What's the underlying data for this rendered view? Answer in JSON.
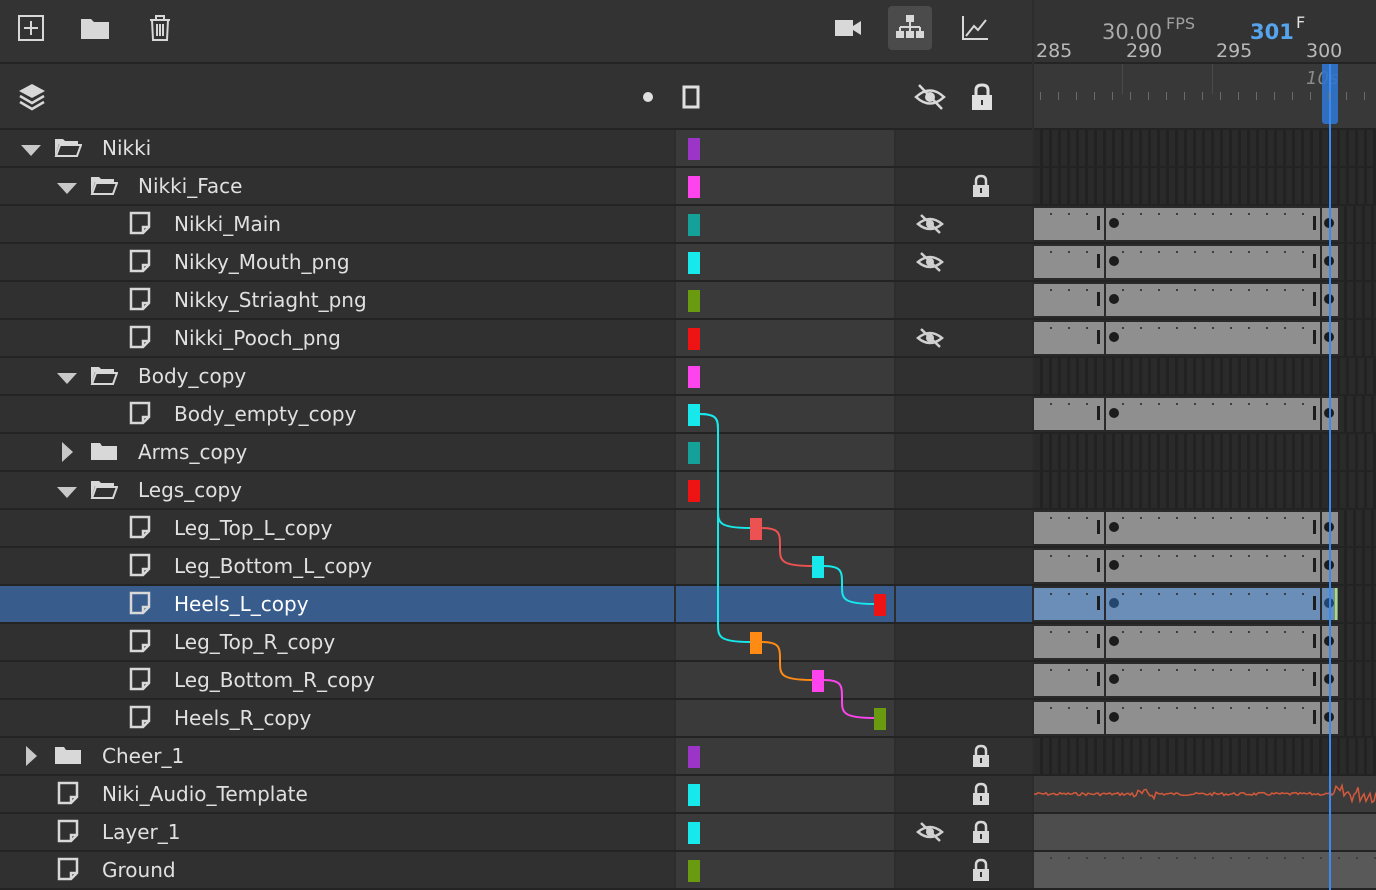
{
  "toolbar": {
    "new_layer_icon": "plus-square-icon",
    "new_folder_icon": "folder-icon",
    "delete_icon": "trash-icon",
    "camera_icon": "camera-icon",
    "parenting_icon": "hierarchy-icon",
    "graph_icon": "graph-icon",
    "fps_value": "30.00",
    "fps_unit": "FPS",
    "frame_value": "301",
    "frame_unit": "F"
  },
  "header": {
    "layers_icon": "layers-icon",
    "dot_icon": "dot-icon",
    "outline_icon": "outline-icon",
    "hide_all_icon": "eye-slash-icon",
    "lock_all_icon": "lock-icon"
  },
  "ruler": {
    "seconds_label": "10s",
    "frames": [
      "285",
      "290",
      "295",
      "300"
    ]
  },
  "colors": {
    "accent_blue": "#56a4ee",
    "playhead": "#3a8af0",
    "selection": "#385c8c",
    "audio_wave": "#d4593a"
  },
  "layers": [
    {
      "name": "Nikki",
      "type": "folder",
      "depth": 0,
      "expanded": true,
      "color": "#9b35c8",
      "hidden": false,
      "locked": false,
      "frames": "empty"
    },
    {
      "name": "Nikki_Face",
      "type": "folder",
      "depth": 1,
      "expanded": true,
      "color": "#ff44ee",
      "hidden": false,
      "locked": true,
      "frames": "empty"
    },
    {
      "name": "Nikki_Main",
      "type": "layer",
      "depth": 2,
      "color": "#14a19a",
      "hidden": true,
      "locked": false,
      "frames": "keys"
    },
    {
      "name": "Nikky_Mouth_png",
      "type": "layer",
      "depth": 2,
      "color": "#16e8ec",
      "hidden": true,
      "locked": false,
      "frames": "keys"
    },
    {
      "name": "Nikky_Striaght_png",
      "type": "layer",
      "depth": 2,
      "color": "#6a9a10",
      "hidden": false,
      "locked": false,
      "frames": "keys"
    },
    {
      "name": "Nikki_Pooch_png",
      "type": "layer",
      "depth": 2,
      "color": "#ee1414",
      "hidden": true,
      "locked": false,
      "frames": "keys"
    },
    {
      "name": "Body_copy",
      "type": "folder",
      "depth": 1,
      "expanded": true,
      "color": "#ff44ee",
      "hidden": false,
      "locked": false,
      "frames": "empty"
    },
    {
      "name": "Body_empty_copy",
      "type": "layer",
      "depth": 2,
      "color": "#16e8ec",
      "hidden": false,
      "locked": false,
      "frames": "keys"
    },
    {
      "name": "Arms_copy",
      "type": "folder",
      "depth": 1,
      "expanded": false,
      "color": "#14a19a",
      "hidden": false,
      "locked": false,
      "frames": "empty"
    },
    {
      "name": "Legs_copy",
      "type": "folder",
      "depth": 1,
      "expanded": true,
      "color": "#ee1414",
      "hidden": false,
      "locked": false,
      "frames": "empty"
    },
    {
      "name": "Leg_Top_L_copy",
      "type": "layer",
      "depth": 2,
      "color": "#ec5252",
      "hidden": false,
      "locked": false,
      "frames": "keys"
    },
    {
      "name": "Leg_Bottom_L_copy",
      "type": "layer",
      "depth": 2,
      "color": "#16e8ec",
      "hidden": false,
      "locked": false,
      "frames": "keys"
    },
    {
      "name": "Heels_L_copy",
      "type": "layer",
      "depth": 2,
      "color": "#ee1414",
      "hidden": false,
      "locked": false,
      "frames": "keys",
      "selected": true
    },
    {
      "name": "Leg_Top_R_copy",
      "type": "layer",
      "depth": 2,
      "color": "#ff8a14",
      "hidden": false,
      "locked": false,
      "frames": "keys"
    },
    {
      "name": "Leg_Bottom_R_copy",
      "type": "layer",
      "depth": 2,
      "color": "#ff44ee",
      "hidden": false,
      "locked": false,
      "frames": "keys"
    },
    {
      "name": "Heels_R_copy",
      "type": "layer",
      "depth": 2,
      "color": "#6a9a10",
      "hidden": false,
      "locked": false,
      "frames": "keys"
    },
    {
      "name": "Cheer_1",
      "type": "folder",
      "depth": 0,
      "expanded": false,
      "color": "#9b35c8",
      "hidden": false,
      "locked": true,
      "frames": "empty"
    },
    {
      "name": "Niki_Audio_Template",
      "type": "layer",
      "depth": 0,
      "color": "#16e8ec",
      "hidden": false,
      "locked": true,
      "frames": "audio"
    },
    {
      "name": "Layer_1",
      "type": "layer",
      "depth": 0,
      "color": "#16e8ec",
      "hidden": true,
      "locked": true,
      "frames": "plain"
    },
    {
      "name": "Ground",
      "type": "layer",
      "depth": 0,
      "color": "#6a9a10",
      "hidden": false,
      "locked": true,
      "frames": "grey"
    }
  ]
}
